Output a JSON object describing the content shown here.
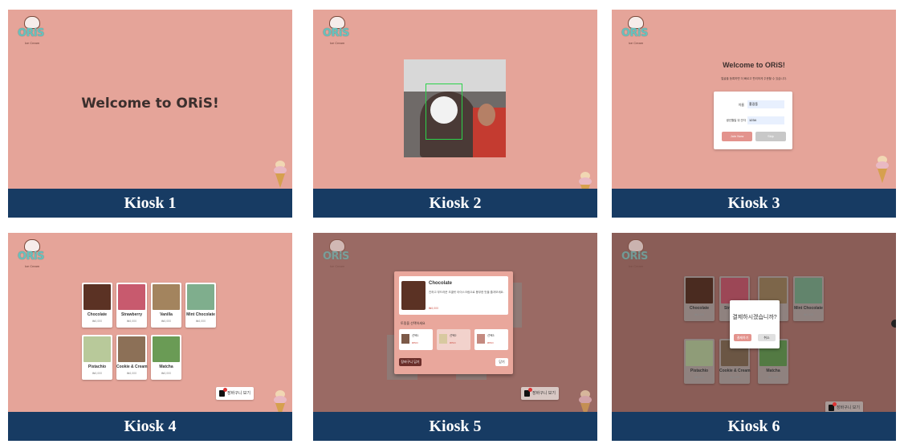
{
  "logo": {
    "word": "ORiS",
    "sub": "Ice Cream"
  },
  "kiosks": [
    {
      "caption": "Kiosk 1",
      "welcome": "Welcome to ORiS!"
    },
    {
      "caption": "Kiosk 2"
    },
    {
      "caption": "Kiosk 3",
      "title": "Welcome to ORiS!",
      "subtitle": "얼굴을 등록하면 더 빠르고 편리하게 주문할 수 있습니다.",
      "fields": [
        {
          "label": "이름",
          "value": "홍길동"
        },
        {
          "label": "생년월일 뒤 숫자",
          "value": "1234"
        }
      ],
      "primary_button": "Join Now",
      "secondary_button": "Skip"
    },
    {
      "caption": "Kiosk 4",
      "menu": [
        {
          "name": "Chocolate",
          "price": "₩4,000",
          "color": "#5b3224"
        },
        {
          "name": "Strawberry",
          "price": "₩4,000",
          "color": "#c85a6e"
        },
        {
          "name": "Vanilla",
          "price": "₩4,000",
          "color": "#a3845e"
        },
        {
          "name": "Mint Chocolate",
          "price": "₩4,000",
          "color": "#7fae8d"
        },
        {
          "name": "Pistachio",
          "price": "₩4,000",
          "color": "#b8c99a"
        },
        {
          "name": "Cookie & Cream",
          "price": "₩4,000",
          "color": "#8c7057"
        },
        {
          "name": "Matcha",
          "price": "₩4,000",
          "color": "#6a9b55"
        }
      ],
      "cart_label": "장바구니 보기",
      "cart_count": "1"
    },
    {
      "caption": "Kiosk 5",
      "modal": {
        "title": "Chocolate",
        "desc": "진하고 부드러운 초콜릿 아이스크림으로 풍부한 맛을 즐겨보세요.",
        "price": "₩4,000",
        "section": "토핑을 선택하세요",
        "options": [
          {
            "name": "선택1",
            "price": "₩500"
          },
          {
            "name": "선택2",
            "price": "₩500"
          },
          {
            "name": "선택3",
            "price": "₩500"
          }
        ],
        "add_button": "장바구니 담기",
        "close_button": "닫기"
      },
      "cart_label": "장바구니 보기",
      "cart_count": "1"
    },
    {
      "caption": "Kiosk 6",
      "dialog": {
        "question": "결제하시겠습니까?",
        "yes": "결제하기",
        "no": "취소"
      },
      "cart_label": "장바구니 보기",
      "cart_count": "2"
    }
  ],
  "colors": {
    "screen_bg": "#e5a499",
    "caption_bg": "#173b63",
    "accent": "#e3938d"
  }
}
